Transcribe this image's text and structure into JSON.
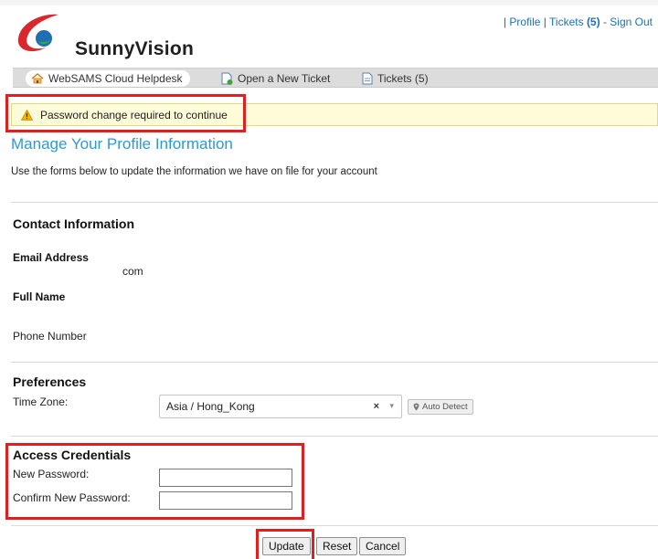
{
  "brand": {
    "name": "SunnyVision"
  },
  "top_links": {
    "profile": "Profile",
    "tickets": "Tickets",
    "tickets_count": "(5)",
    "separator": "|",
    "dash": "-",
    "sign_out": "Sign Out"
  },
  "nav": {
    "items": [
      {
        "label": "WebSAMS Cloud Helpdesk",
        "icon": "home-icon",
        "active": true
      },
      {
        "label": "Open a New Ticket",
        "icon": "new-ticket-icon",
        "active": false
      },
      {
        "label": "Tickets (5)",
        "icon": "tickets-icon",
        "active": false
      }
    ]
  },
  "notice": {
    "text": "Password change required to continue",
    "icon": "warning-icon"
  },
  "page": {
    "title": "Manage Your Profile Information",
    "intro": "Use the forms below to update the information we have on file for your account"
  },
  "contact": {
    "heading": "Contact Information",
    "email_label": "Email Address",
    "email_value": "com",
    "fullname_label": "Full Name",
    "phone_label": "Phone Number"
  },
  "preferences": {
    "heading": "Preferences",
    "timezone_label": "Time Zone:",
    "timezone_value": "Asia / Hong_Kong",
    "clear_symbol": "×",
    "dropdown_symbol": "▾",
    "auto_detect_label": "Auto Detect"
  },
  "credentials": {
    "heading": "Access Credentials",
    "new_password_label": "New Password:",
    "confirm_password_label": "Confirm New Password:"
  },
  "buttons": {
    "update": "Update",
    "reset": "Reset",
    "cancel": "Cancel"
  },
  "colors": {
    "accent": "#2a9ad6",
    "link": "#1a72b8",
    "warning_bg": "#fefbd8",
    "highlight_red": "#e02020",
    "logo_red": "#d9272e",
    "logo_green": "#3aa63c",
    "logo_blue": "#1f6fb5"
  }
}
